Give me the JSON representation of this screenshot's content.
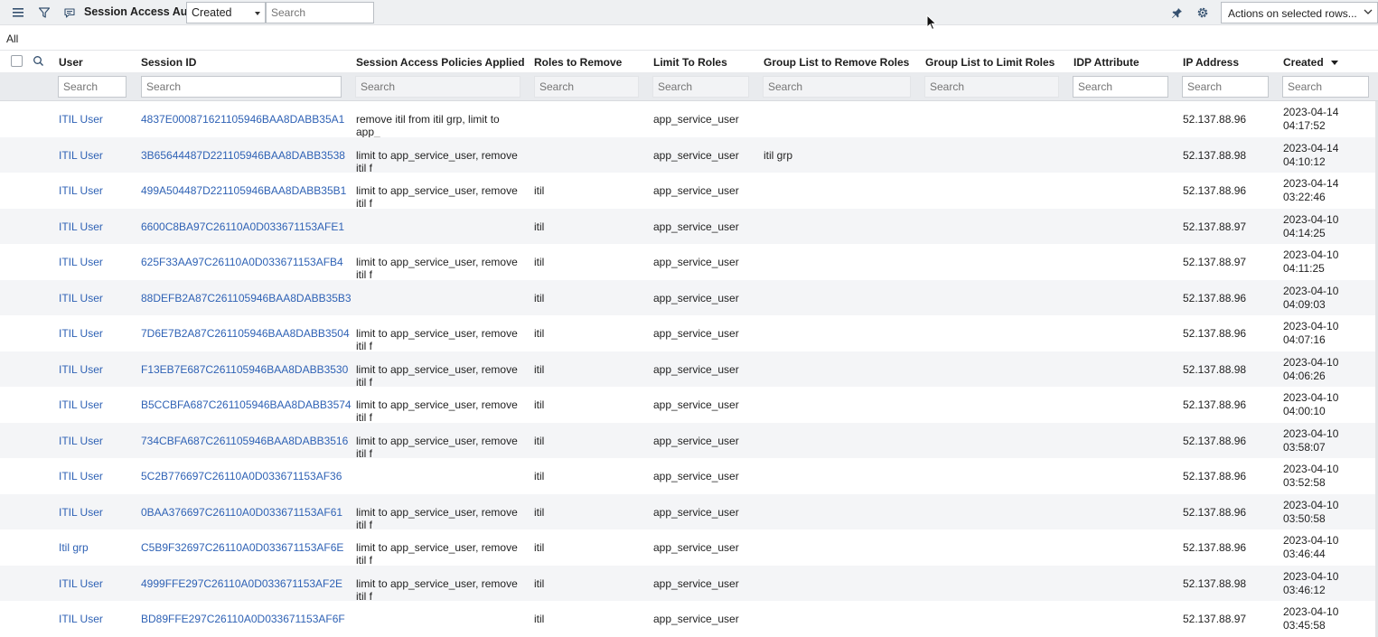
{
  "toolbar": {
    "title": "Session Access Audits",
    "filter_field": "Created",
    "search_placeholder": "Search",
    "actions_label": "Actions on selected rows..."
  },
  "breadcrumb": "All",
  "columns": [
    {
      "label": "User",
      "filter_placeholder": "Search"
    },
    {
      "label": "Session ID",
      "filter_placeholder": "Search"
    },
    {
      "label": "Session Access Policies Applied",
      "filter_placeholder": "Search"
    },
    {
      "label": "Roles to Remove",
      "filter_placeholder": "Search"
    },
    {
      "label": "Limit To Roles",
      "filter_placeholder": "Search"
    },
    {
      "label": "Group List to Remove Roles",
      "filter_placeholder": "Search"
    },
    {
      "label": "Group List to Limit Roles",
      "filter_placeholder": "Search"
    },
    {
      "label": "IDP Attribute",
      "filter_placeholder": "Search"
    },
    {
      "label": "IP Address",
      "filter_placeholder": "Search"
    },
    {
      "label": "Created",
      "filter_placeholder": "Search"
    }
  ],
  "rows": [
    {
      "user": "ITIL User",
      "session_id": "4837E000871621105946BAA8DABB35A1",
      "policies": "remove itil from itil grp, limit to app_",
      "roles_remove": "",
      "limit_roles": "app_service_user",
      "group_remove": "",
      "group_limit": "",
      "idp": "",
      "ip": "52.137.88.96",
      "created_date": "2023-04-14",
      "created_time": "04:17:52"
    },
    {
      "user": "ITIL User",
      "session_id": "3B65644487D221105946BAA8DABB3538",
      "policies": "limit to app_service_user, remove itil f",
      "roles_remove": "",
      "limit_roles": "app_service_user",
      "group_remove": "itil grp",
      "group_limit": "",
      "idp": "",
      "ip": "52.137.88.98",
      "created_date": "2023-04-14",
      "created_time": "04:10:12"
    },
    {
      "user": "ITIL User",
      "session_id": "499A504487D221105946BAA8DABB35B1",
      "policies": "limit to app_service_user, remove itil f",
      "roles_remove": "itil",
      "limit_roles": "app_service_user",
      "group_remove": "",
      "group_limit": "",
      "idp": "",
      "ip": "52.137.88.96",
      "created_date": "2023-04-14",
      "created_time": "03:22:46"
    },
    {
      "user": "ITIL User",
      "session_id": "6600C8BA97C26110A0D033671153AFE1",
      "policies": "",
      "roles_remove": "itil",
      "limit_roles": "app_service_user",
      "group_remove": "",
      "group_limit": "",
      "idp": "",
      "ip": "52.137.88.97",
      "created_date": "2023-04-10",
      "created_time": "04:14:25"
    },
    {
      "user": "ITIL User",
      "session_id": "625F33AA97C26110A0D033671153AFB4",
      "policies": "limit to app_service_user, remove itil f",
      "roles_remove": "itil",
      "limit_roles": "app_service_user",
      "group_remove": "",
      "group_limit": "",
      "idp": "",
      "ip": "52.137.88.97",
      "created_date": "2023-04-10",
      "created_time": "04:11:25"
    },
    {
      "user": "ITIL User",
      "session_id": "88DEFB2A87C261105946BAA8DABB35B3",
      "policies": "",
      "roles_remove": "itil",
      "limit_roles": "app_service_user",
      "group_remove": "",
      "group_limit": "",
      "idp": "",
      "ip": "52.137.88.96",
      "created_date": "2023-04-10",
      "created_time": "04:09:03"
    },
    {
      "user": "ITIL User",
      "session_id": "7D6E7B2A87C261105946BAA8DABB3504",
      "policies": "limit to app_service_user, remove itil f",
      "roles_remove": "itil",
      "limit_roles": "app_service_user",
      "group_remove": "",
      "group_limit": "",
      "idp": "",
      "ip": "52.137.88.96",
      "created_date": "2023-04-10",
      "created_time": "04:07:16"
    },
    {
      "user": "ITIL User",
      "session_id": "F13EB7E687C261105946BAA8DABB3530",
      "policies": "limit to app_service_user, remove itil f",
      "roles_remove": "itil",
      "limit_roles": "app_service_user",
      "group_remove": "",
      "group_limit": "",
      "idp": "",
      "ip": "52.137.88.98",
      "created_date": "2023-04-10",
      "created_time": "04:06:26"
    },
    {
      "user": "ITIL User",
      "session_id": "B5CCBFA687C261105946BAA8DABB3574",
      "policies": "limit to app_service_user, remove itil f",
      "roles_remove": "itil",
      "limit_roles": "app_service_user",
      "group_remove": "",
      "group_limit": "",
      "idp": "",
      "ip": "52.137.88.96",
      "created_date": "2023-04-10",
      "created_time": "04:00:10"
    },
    {
      "user": "ITIL User",
      "session_id": "734CBFA687C261105946BAA8DABB3516",
      "policies": "limit to app_service_user, remove itil f",
      "roles_remove": "itil",
      "limit_roles": "app_service_user",
      "group_remove": "",
      "group_limit": "",
      "idp": "",
      "ip": "52.137.88.96",
      "created_date": "2023-04-10",
      "created_time": "03:58:07"
    },
    {
      "user": "ITIL User",
      "session_id": "5C2B776697C26110A0D033671153AF36",
      "policies": "",
      "roles_remove": "itil",
      "limit_roles": "app_service_user",
      "group_remove": "",
      "group_limit": "",
      "idp": "",
      "ip": "52.137.88.96",
      "created_date": "2023-04-10",
      "created_time": "03:52:58"
    },
    {
      "user": "ITIL User",
      "session_id": "0BAA376697C26110A0D033671153AF61",
      "policies": "limit to app_service_user, remove itil f",
      "roles_remove": "itil",
      "limit_roles": "app_service_user",
      "group_remove": "",
      "group_limit": "",
      "idp": "",
      "ip": "52.137.88.96",
      "created_date": "2023-04-10",
      "created_time": "03:50:58"
    },
    {
      "user": "Itil grp",
      "session_id": "C5B9F32697C26110A0D033671153AF6E",
      "policies": "limit to app_service_user, remove itil f",
      "roles_remove": "itil",
      "limit_roles": "app_service_user",
      "group_remove": "",
      "group_limit": "",
      "idp": "",
      "ip": "52.137.88.96",
      "created_date": "2023-04-10",
      "created_time": "03:46:44"
    },
    {
      "user": "ITIL User",
      "session_id": "4999FFE297C26110A0D033671153AF2E",
      "policies": "limit to app_service_user, remove itil f",
      "roles_remove": "itil",
      "limit_roles": "app_service_user",
      "group_remove": "",
      "group_limit": "",
      "idp": "",
      "ip": "52.137.88.98",
      "created_date": "2023-04-10",
      "created_time": "03:46:12"
    },
    {
      "user": "ITIL User",
      "session_id": "BD89FFE297C26110A0D033671153AF6F",
      "policies": "",
      "roles_remove": "itil",
      "limit_roles": "app_service_user",
      "group_remove": "",
      "group_limit": "",
      "idp": "",
      "ip": "52.137.88.97",
      "created_date": "2023-04-10",
      "created_time": "03:45:58"
    }
  ],
  "icons": {
    "menu": "hamburger-icon",
    "filter": "filter-funnel-icon",
    "context": "chat-bubble-icon",
    "pin": "pin-icon",
    "settings": "gear-icon",
    "sort": "sort-descending-icon"
  },
  "colors": {
    "link": "#2f62b5",
    "toolbar_bg": "#eef0f2",
    "filter_row_bg": "#e9ebee",
    "alt_row_bg": "#f4f5f7"
  }
}
